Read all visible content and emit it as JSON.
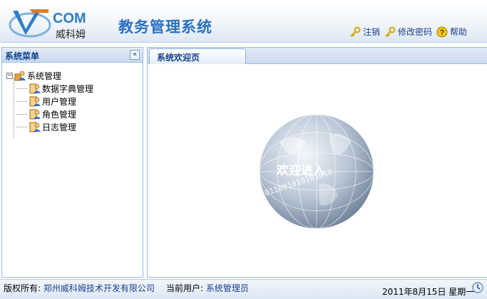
{
  "header": {
    "logo_brand": "COM",
    "logo_cn": "威科姆",
    "title": "教务管理系统",
    "links": [
      {
        "label": "注销",
        "icon": "key-icon"
      },
      {
        "label": "修改密码",
        "icon": "key-icon"
      },
      {
        "label": "帮助",
        "icon": "help-icon"
      }
    ]
  },
  "sidebar": {
    "title": "系统菜单",
    "collapse_glyph": "«",
    "tree": {
      "root": {
        "label": "系统管理",
        "expander": "−"
      },
      "children": [
        "数据字典管理",
        "用户管理",
        "角色管理",
        "日志管理"
      ]
    }
  },
  "content": {
    "tab_label": "系统欢迎页",
    "welcome_text": "欢迎进入",
    "binary_text": "01011001010101010"
  },
  "footer": {
    "copyright_label": "版权所有:",
    "company": "郑州威科姆技术开发有限公司",
    "user_label": "当前用户:",
    "user": "系统管理员",
    "date": "2011年8月15日  星期一"
  },
  "colors": {
    "accent": "#2b70c0",
    "panel_border": "#99bbe8",
    "link": "#1f3f8e"
  }
}
